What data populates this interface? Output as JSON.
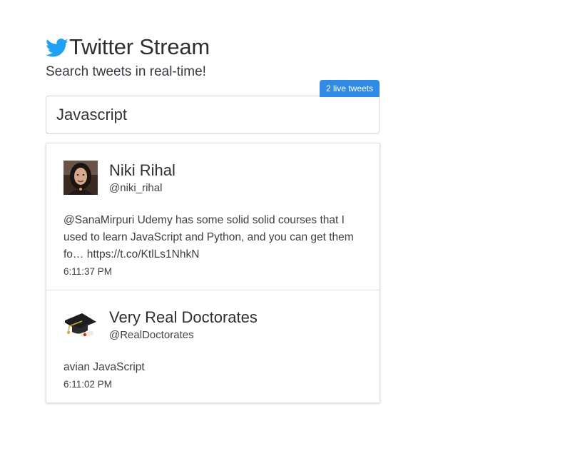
{
  "header": {
    "title": "Twitter Stream",
    "subtitle": "Search tweets in real-time!",
    "brand_color": "#1da1f2"
  },
  "badge": {
    "label": "2 live tweets",
    "color": "#2f8be6"
  },
  "search": {
    "value": "Javascript"
  },
  "tweets": [
    {
      "name": "Niki Rihal",
      "handle": "@niki_rihal",
      "text": "@SanaMirpuri Udemy has some solid solid courses that I used to learn JavaScript and Python, and you can get them fo… https://t.co/KtlLs1NhkN",
      "time": "6:11:37 PM",
      "avatar_icon": "profile-photo"
    },
    {
      "name": "Very Real Doctorates",
      "handle": "@RealDoctorates",
      "text": "avian JavaScript",
      "time": "6:11:02 PM",
      "avatar_icon": "graduation-cap-icon"
    }
  ]
}
